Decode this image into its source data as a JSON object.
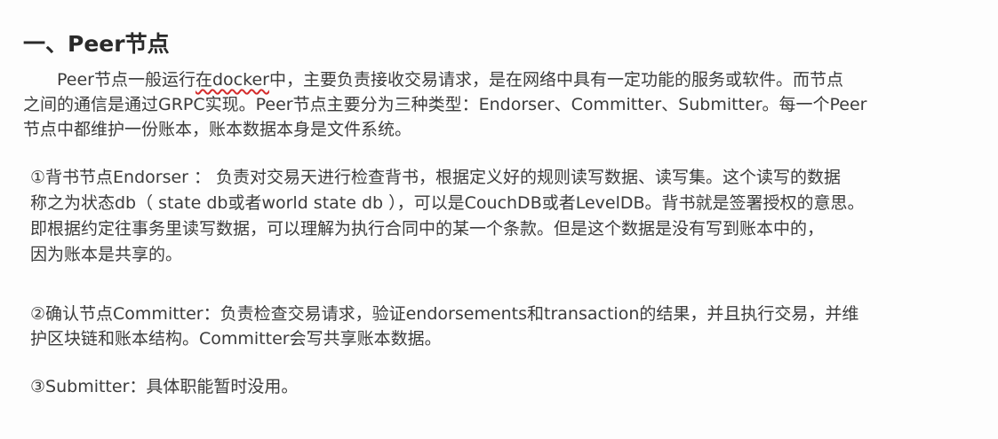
{
  "heading": "一、Peer节点",
  "intro": {
    "line1_pre": "Peer节点一般运行",
    "line1_mark": "在docker",
    "line1_post": "中，主要负责接收交易请求，是在网络中具有一定功能的服务或软件。而节点",
    "line2": "之间的通信是通过GRPC实现。Peer节点主要分为三种类型：Endorser、Committer、Submitter。每一个Peer",
    "line3": "节点中都维护一份账本，账本数据本身是文件系统。"
  },
  "item1": {
    "line1": "①背书节点Endorser ： 负责对交易天进行检查背书，根据定义好的规则读写数据、读写集。这个读写的数据",
    "line2": "称之为状态db（ state  db或者world  state  db ），可以是CouchDB或者LevelDB。背书就是签署授权的意思。",
    "line3": "即根据约定往事务里读写数据，可以理解为执行合同中的某一个条款。但是这个数据是没有写到账本中的，",
    "line4": "因为账本是共享的。"
  },
  "item2": {
    "line1": "②确认节点Committer：负责检查交易请求，验证endorsements和transaction的结果，并且执行交易，并维",
    "line2": "护区块链和账本结构。Committer会写共享账本数据。"
  },
  "item3": {
    "line1": "③Submitter：具体职能暂时没用。"
  }
}
